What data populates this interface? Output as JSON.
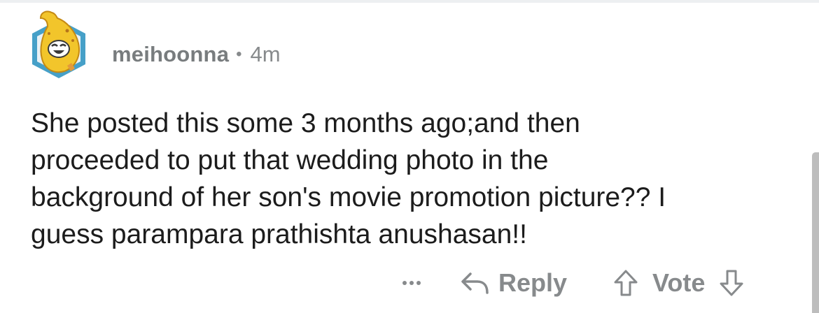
{
  "comment": {
    "username": "meihoonna",
    "separator": "•",
    "age": "4m",
    "body_lines": [
      "She posted this some 3 months ago;and then",
      "proceeded to put that wedding photo in the",
      "background of her son's movie promotion picture?? I",
      "guess parampara prathishta anushasan!!"
    ]
  },
  "actions": {
    "more_label": "...",
    "reply_label": "Reply",
    "vote_label": "Vote"
  },
  "icons": {
    "avatar": "banana-avatar-icon",
    "more": "ellipsis-icon",
    "reply": "reply-arrow-icon",
    "upvote": "upvote-arrow-icon",
    "downvote": "downvote-arrow-icon"
  },
  "colors": {
    "avatar_frame": "#46a0c8",
    "avatar_banana": "#f2c52b",
    "meta_text": "#878a8c",
    "body_text": "#1c1c1c"
  }
}
